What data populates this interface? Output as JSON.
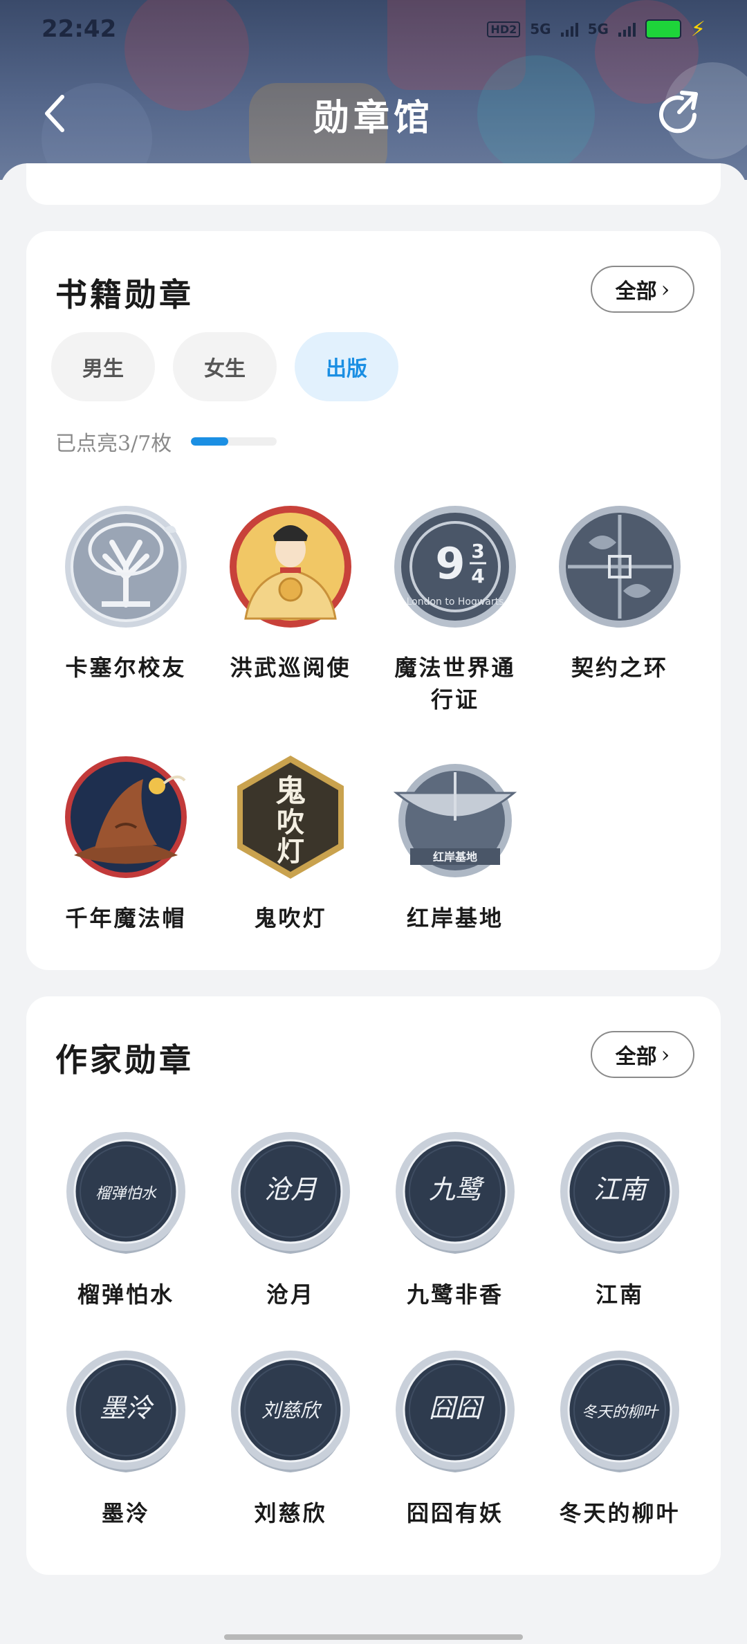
{
  "status_bar": {
    "time": "22:42",
    "network_1": "5G",
    "network_2": "5G",
    "hd_label": "HD2",
    "battery_color": "#1ed43a"
  },
  "nav": {
    "title": "勋章馆",
    "back_icon": "chevron-left-icon",
    "refresh_icon": "refresh-icon"
  },
  "book_section": {
    "title": "书籍勋章",
    "all_label": "全部",
    "tabs": [
      {
        "label": "男生",
        "active": false
      },
      {
        "label": "女生",
        "active": false
      },
      {
        "label": "出版",
        "active": true
      }
    ],
    "progress_text": "已点亮3/7枚",
    "progress_fraction": 0.43,
    "medals": [
      {
        "label": "卡塞尔校友",
        "icon": "tree-icon"
      },
      {
        "label": "洪武巡阅使",
        "icon": "emperor-icon"
      },
      {
        "label": "魔法世界通行证",
        "icon": "platform-icon",
        "icon_text": "9¾"
      },
      {
        "label": "契约之环",
        "icon": "ring-icon"
      },
      {
        "label": "千年魔法帽",
        "icon": "wizard-hat-icon"
      },
      {
        "label": "鬼吹灯",
        "icon": "lantern-icon",
        "icon_text": "鬼吹灯"
      },
      {
        "label": "红岸基地",
        "icon": "radar-icon",
        "icon_text": "红岸基地"
      }
    ]
  },
  "author_section": {
    "title": "作家勋章",
    "all_label": "全部",
    "medals": [
      {
        "label": "榴弹怕水",
        "signature": "榴弹怕水"
      },
      {
        "label": "沧月",
        "signature": "沧月"
      },
      {
        "label": "九鹭非香",
        "signature": "九鹭"
      },
      {
        "label": "江南",
        "signature": "江南"
      },
      {
        "label": "墨泠",
        "signature": "墨泠"
      },
      {
        "label": "刘慈欣",
        "signature": "刘慈欣"
      },
      {
        "label": "囧囧有妖",
        "signature": "囧囧"
      },
      {
        "label": "冬天的柳叶",
        "signature": "冬天的柳叶"
      }
    ]
  },
  "colors": {
    "accent": "#1b8fe3",
    "header": "#4b5c80"
  }
}
